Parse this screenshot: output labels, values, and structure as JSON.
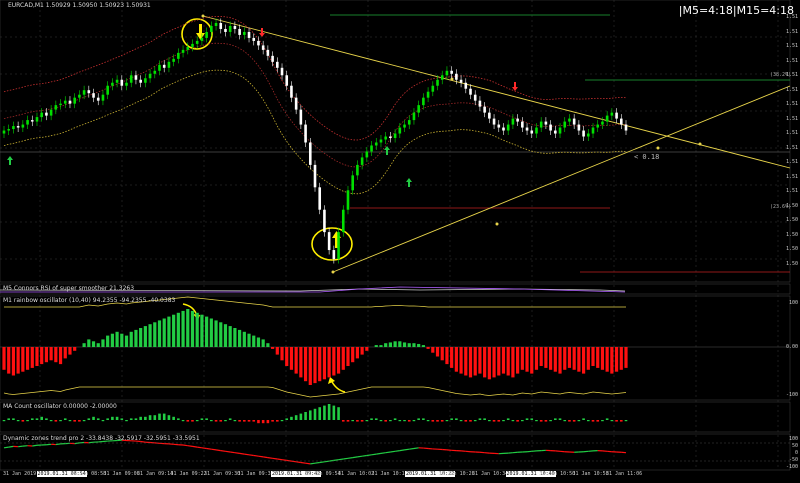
{
  "header": {
    "symbol_info": "EURCAD,M1  1.50929 1.50950 1.50923 1.50931",
    "timer": "|M5=4:18|M15=4:18",
    "price_tag": "< 0.18",
    "fib_top": "(38.2%)",
    "fib_bottom": "(23.6%)"
  },
  "indicators": {
    "rsi": "M5 Connors RSI of super smoother 21.3263",
    "rainbow": "M1 rainbow oscillator (10,40) 94.2355 -94.2355 -40.0383",
    "ma_count": "MA Count oscillator 0.00000 -2.00000",
    "dynamic": "Dynamic zones trend pro 2 -33.8438 -32.5917 -32.5951 -33.5951"
  },
  "price_axis": [
    "1.51",
    "1.51",
    "1.51",
    "1.51",
    "1.51",
    "1.51",
    "1.51",
    "1.51",
    "1.51",
    "1.51",
    "1.51",
    "1.51",
    "1.51",
    "1.50",
    "1.50",
    "1.50",
    "1.50",
    "1.50"
  ],
  "rainbow_axis": [
    "100",
    "0.00",
    "-100"
  ],
  "dynamic_axis": [
    "100",
    "50",
    "0",
    "-50",
    "-100"
  ],
  "time_axis": [
    {
      "label": "31 Jan 2019",
      "hl": false
    },
    {
      "label": "2019.01.31 08:54",
      "hl": true
    },
    {
      "label": "31 Jan 08:58",
      "hl": false
    },
    {
      "label": "31 Jan 09:06",
      "hl": false
    },
    {
      "label": "31 Jan 09:14",
      "hl": false
    },
    {
      "label": "31 Jan 09:22",
      "hl": false
    },
    {
      "label": "31 Jan 09:30",
      "hl": false
    },
    {
      "label": "31 Jan 09:38",
      "hl": false
    },
    {
      "label": "2019.01.31 09:42",
      "hl": true
    },
    {
      "label": "31 Jan 09:54",
      "hl": false
    },
    {
      "label": "31 Jan 10:02",
      "hl": false
    },
    {
      "label": "31 Jan 10:10",
      "hl": false
    },
    {
      "label": "2019.01.31 10:22",
      "hl": true
    },
    {
      "label": "31 Jan 10:26",
      "hl": false
    },
    {
      "label": "31 Jan 10:34",
      "hl": false
    },
    {
      "label": "2019.01.31 10:40",
      "hl": true
    },
    {
      "label": "31 Jan 10:50",
      "hl": false
    },
    {
      "label": "31 Jan 10:58",
      "hl": false
    },
    {
      "label": "31 Jan 11:06",
      "hl": false
    }
  ],
  "colors": {
    "bull": "#00e000",
    "bear": "#ffffff",
    "up_hist": "#22cc44",
    "down_hist": "#ff1010",
    "trendline": "#e8d44a",
    "grid": "#2a2a2a",
    "annot": "#ffee00"
  },
  "chart_data": {
    "type": "candlestick",
    "closes": [
      0.18,
      0.19,
      0.21,
      0.2,
      0.22,
      0.25,
      0.24,
      0.27,
      0.3,
      0.28,
      0.32,
      0.35,
      0.36,
      0.38,
      0.36,
      0.4,
      0.42,
      0.45,
      0.43,
      0.4,
      0.38,
      0.42,
      0.48,
      0.5,
      0.52,
      0.48,
      0.5,
      0.55,
      0.52,
      0.5,
      0.53,
      0.56,
      0.58,
      0.62,
      0.6,
      0.64,
      0.66,
      0.7,
      0.72,
      0.74,
      0.76,
      0.78,
      0.8,
      0.84,
      0.88,
      0.9,
      0.86,
      0.84,
      0.88,
      0.86,
      0.82,
      0.84,
      0.8,
      0.78,
      0.75,
      0.72,
      0.68,
      0.64,
      0.6,
      0.55,
      0.48,
      0.4,
      0.32,
      0.22,
      0.1,
      -0.05,
      -0.2,
      -0.35,
      -0.5,
      -0.62,
      -0.68,
      -0.5,
      -0.35,
      -0.22,
      -0.12,
      -0.05,
      0.0,
      0.04,
      0.08,
      0.1,
      0.12,
      0.14,
      0.13,
      0.16,
      0.2,
      0.22,
      0.25,
      0.3,
      0.35,
      0.4,
      0.44,
      0.48,
      0.52,
      0.55,
      0.58,
      0.56,
      0.52,
      0.5,
      0.46,
      0.42,
      0.38,
      0.34,
      0.3,
      0.26,
      0.22,
      0.2,
      0.18,
      0.22,
      0.26,
      0.24,
      0.2,
      0.18,
      0.16,
      0.2,
      0.24,
      0.22,
      0.18,
      0.16,
      0.2,
      0.24,
      0.26,
      0.22,
      0.18,
      0.14,
      0.16,
      0.2,
      0.22,
      0.24,
      0.28,
      0.3,
      0.26,
      0.22,
      0.18
    ],
    "rainbow": [
      -0.6,
      -0.7,
      -0.75,
      -0.7,
      -0.65,
      -0.6,
      -0.55,
      -0.5,
      -0.45,
      -0.4,
      -0.35,
      -0.4,
      -0.45,
      -0.3,
      -0.2,
      -0.1,
      0.0,
      0.1,
      0.2,
      0.15,
      0.1,
      0.2,
      0.3,
      0.35,
      0.4,
      0.35,
      0.3,
      0.4,
      0.45,
      0.5,
      0.55,
      0.6,
      0.65,
      0.7,
      0.75,
      0.8,
      0.85,
      0.9,
      0.95,
      1.0,
      0.95,
      0.9,
      0.85,
      0.8,
      0.75,
      0.7,
      0.65,
      0.6,
      0.55,
      0.5,
      0.45,
      0.4,
      0.35,
      0.3,
      0.25,
      0.2,
      0.1,
      -0.05,
      -0.2,
      -0.35,
      -0.5,
      -0.6,
      -0.7,
      -0.8,
      -0.9,
      -1.0,
      -0.95,
      -0.9,
      -0.85,
      -0.8,
      -0.75,
      -0.7,
      -0.6,
      -0.5,
      -0.4,
      -0.3,
      -0.2,
      -0.1,
      0.0,
      0.05,
      0.05,
      0.1,
      0.12,
      0.15,
      0.15,
      0.12,
      0.1,
      0.1,
      0.08,
      0.05,
      -0.05,
      -0.15,
      -0.25,
      -0.35,
      -0.45,
      -0.55,
      -0.65,
      -0.7,
      -0.75,
      -0.8,
      -0.75,
      -0.7,
      -0.8,
      -0.85,
      -0.8,
      -0.75,
      -0.7,
      -0.75,
      -0.8,
      -0.7,
      -0.6,
      -0.65,
      -0.7,
      -0.6,
      -0.5,
      -0.55,
      -0.6,
      -0.65,
      -0.7,
      -0.6,
      -0.55,
      -0.6,
      -0.65,
      -0.7,
      -0.6,
      -0.5,
      -0.55,
      -0.6,
      -0.65,
      -0.7,
      -0.65,
      -0.6,
      -0.55
    ],
    "ma_count": [
      0,
      1,
      1,
      0,
      -1,
      0,
      1,
      1,
      2,
      1,
      0,
      -1,
      0,
      1,
      0,
      -1,
      -1,
      0,
      1,
      2,
      1,
      0,
      1,
      2,
      2,
      1,
      0,
      1,
      1,
      2,
      2,
      3,
      3,
      4,
      4,
      3,
      2,
      1,
      0,
      -1,
      -1,
      0,
      1,
      1,
      0,
      -1,
      -1,
      0,
      1,
      0,
      -1,
      -1,
      -1,
      -1,
      -2,
      -2,
      -2,
      -1,
      -1,
      0,
      1,
      2,
      3,
      4,
      5,
      6,
      7,
      8,
      9,
      10,
      9,
      8,
      -1,
      -1,
      0,
      -1,
      -1,
      0,
      1,
      1,
      0,
      -1,
      0,
      1,
      0,
      0,
      -1,
      0,
      1,
      1,
      0,
      -1,
      -1,
      -1,
      0,
      1,
      1,
      0,
      -1,
      -1,
      0,
      1,
      1,
      0,
      -1,
      -1,
      0,
      1,
      0,
      -1,
      0,
      1,
      1,
      0,
      -1,
      -1,
      0,
      1,
      1,
      0,
      -1,
      -1,
      0,
      1,
      0,
      -1,
      -1,
      0,
      1,
      0,
      -1,
      -1,
      0
    ],
    "dynamic": [
      0.3,
      0.35,
      0.4,
      0.38,
      0.42,
      0.45,
      0.43,
      0.48,
      0.5,
      0.52,
      0.55,
      0.53,
      0.58,
      0.6,
      0.62,
      0.6,
      0.65,
      0.68,
      0.66,
      0.7,
      0.72,
      0.75,
      0.78,
      0.8,
      0.82,
      0.85,
      0.82,
      0.8,
      0.78,
      0.75,
      0.7,
      0.68,
      0.65,
      0.62,
      0.6,
      0.58,
      0.55,
      0.52,
      0.5,
      0.45,
      0.4,
      0.35,
      0.3,
      0.25,
      0.2,
      0.15,
      0.1,
      0.05,
      0.0,
      -0.05,
      -0.1,
      -0.15,
      -0.2,
      -0.25,
      -0.3,
      -0.35,
      -0.4,
      -0.45,
      -0.5,
      -0.55,
      -0.6,
      -0.65,
      -0.7,
      -0.75,
      -0.8,
      -0.85,
      -0.8,
      -0.75,
      -0.7,
      -0.65,
      -0.6,
      -0.55,
      -0.5,
      -0.45,
      -0.4,
      -0.35,
      -0.3,
      -0.25,
      -0.2,
      -0.15,
      -0.1,
      -0.05,
      0.0,
      0.05,
      0.1,
      0.15,
      0.2,
      0.25,
      0.3,
      0.28,
      0.25,
      0.22,
      0.2,
      0.18,
      0.15,
      0.12,
      0.1,
      0.08,
      0.05,
      0.02,
      0.0,
      -0.02,
      -0.05,
      -0.08,
      -0.1,
      -0.12,
      -0.1,
      -0.08,
      -0.05,
      -0.02,
      0.0,
      0.02,
      0.05,
      0.08,
      0.1,
      0.12,
      0.1,
      0.08,
      0.05,
      0.02,
      0.0,
      -0.02,
      0.0,
      0.02,
      0.05,
      0.08,
      0.1,
      0.08,
      0.05,
      0.02,
      0.0,
      -0.02,
      -0.05
    ]
  }
}
